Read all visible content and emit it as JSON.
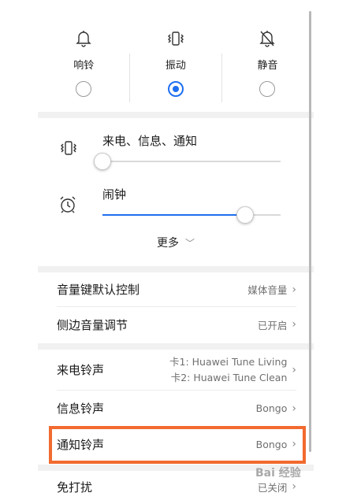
{
  "modes": [
    {
      "label": "响铃",
      "icon": "bell-icon",
      "selected": false
    },
    {
      "label": "振动",
      "icon": "vibrate-icon",
      "selected": true
    },
    {
      "label": "静音",
      "icon": "bell-off-icon",
      "selected": false
    }
  ],
  "sliders": [
    {
      "title": "来电、信息、通知",
      "icon": "vibrate-icon",
      "level": 0.0
    },
    {
      "title": "闹钟",
      "icon": "alarm-clock-icon",
      "level": 0.8
    }
  ],
  "more_label": "更多",
  "settings": [
    {
      "label": "音量键默认控制",
      "value": "媒体音量"
    },
    {
      "label": "侧边音量调节",
      "value": "已开启"
    },
    {
      "label": "来电铃声",
      "value_lines": [
        "卡1: Huawei Tune Living",
        "卡2: Huawei Tune Clean"
      ]
    },
    {
      "label": "信息铃声",
      "value": "Bongo"
    },
    {
      "label": "通知铃声",
      "value": "Bongo",
      "highlighted": true
    },
    {
      "label": "免打扰",
      "value": "已关闭"
    }
  ],
  "colors": {
    "accent": "#1e6ff0",
    "highlight": "#f26a2e"
  },
  "watermark": "Bai 经验"
}
